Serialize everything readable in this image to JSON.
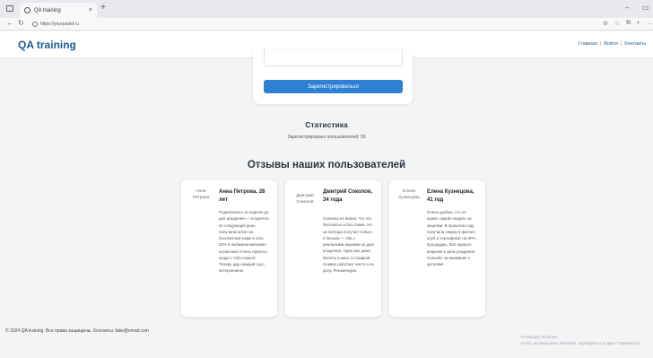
{
  "browser": {
    "tab_title": "QA training",
    "tab_close": "×",
    "new_tab": "+",
    "url": "https://yourpadel.ru",
    "icons": [
      "window-icon",
      "back-icon",
      "refresh-icon",
      "lock-icon",
      "minimize-icon",
      "restore-icon",
      "favorite-icon",
      "collections-icon",
      "extensions-icon",
      "more-icon"
    ]
  },
  "header": {
    "logo": "QA training",
    "nav": [
      "Главная",
      "Войти",
      "Контакты"
    ],
    "sep": "|"
  },
  "form": {
    "submit_label": "Зарегистрироваться"
  },
  "stats": {
    "title": "Статистика",
    "text": "Зарегистрировано пользователей: 55"
  },
  "reviews": {
    "title": "Отзывы наших пользователей",
    "items": [
      {
        "avatar_alt": "Анна Петрова",
        "name": "Анна Петрова, 28 лет",
        "text": "Подписалась за неделю до дня рождения — и приятно по следующей день получила купон на бесплатный кофе в сеть 30% в любимом магазине косметики! Очень приятно, когда о тебе помнят. Теперь жду каждый год с нетерпением."
      },
      {
        "avatar_alt": "Дмитрий Соколов",
        "name": "Дмитрий Соколов, 34 года",
        "text": "Сначала не верил, что это бесплатно и без спама. Но за полгода получил только 2 письма — оба с реальными акциями ко дню рождения. Один раз даже билеты в кино со скидкой. Сервис работает чисто и по делу. Рекомендую."
      },
      {
        "avatar_alt": "Елена Кузнецова",
        "name": "Елена Кузнецова, 41 год",
        "text": "Очень удобно, что не нужно самой следить за акциями. В прошлом году получила скидку в фитнес-клуб и сертификат на SPA-процедуры. Всё пришло вовремя в день рождения. Спасибо за внимание к деталям!"
      }
    ]
  },
  "footer": {
    "text": "© 2024 QA training. Все права защищены. Контакты: fake@email.com"
  },
  "watermark": {
    "line1": "Активация Windows",
    "line2": "Чтобы активировать Windows, перейдите в раздел \"Параметры\"."
  }
}
